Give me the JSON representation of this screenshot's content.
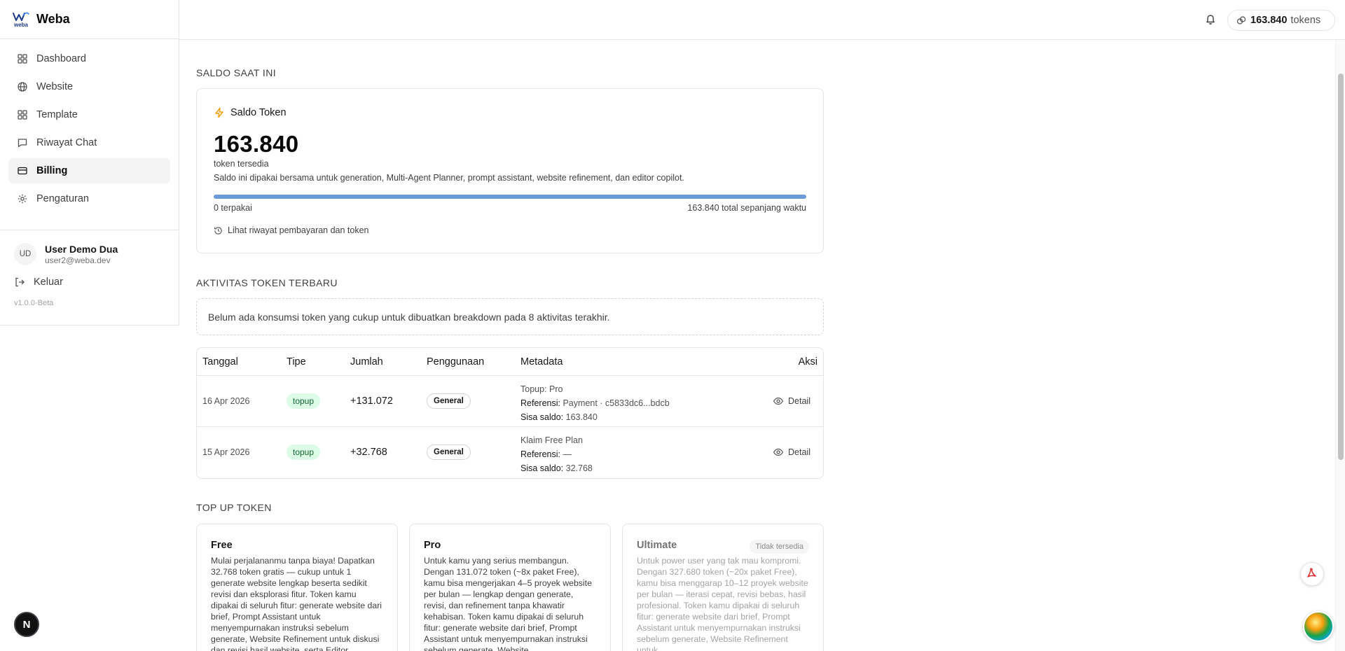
{
  "brand": {
    "name": "Weba",
    "logo_text": "weba"
  },
  "sidebar": {
    "items": [
      {
        "label": "Dashboard",
        "icon": "dashboard-icon",
        "active": false
      },
      {
        "label": "Website",
        "icon": "globe-icon",
        "active": false
      },
      {
        "label": "Template",
        "icon": "template-grid-icon",
        "active": false
      },
      {
        "label": "Riwayat Chat",
        "icon": "chat-icon",
        "active": false
      },
      {
        "label": "Billing",
        "icon": "credit-card-icon",
        "active": true
      },
      {
        "label": "Pengaturan",
        "icon": "gear-icon",
        "active": false
      }
    ],
    "user": {
      "initials": "UD",
      "name": "User Demo Dua",
      "email": "user2@weba.dev"
    },
    "logout_label": "Keluar",
    "version": "v1.0.0-Beta"
  },
  "header": {
    "token_count": "163.840",
    "token_unit": "tokens"
  },
  "saldo": {
    "section_title": "SALDO SAAT INI",
    "card_title": "Saldo Token",
    "amount": "163.840",
    "amount_sub": "token tersedia",
    "description": "Saldo ini dipakai bersama untuk generation, Multi-Agent Planner, prompt assistant, website refinement, dan editor copilot.",
    "used_label": "0 terpakai",
    "total_label": "163.840 total sepanjang waktu",
    "remaining_fraction": 1.0,
    "history_link": "Lihat riwayat pembayaran dan token"
  },
  "activity": {
    "section_title": "AKTIVITAS TOKEN TERBARU",
    "empty_message": "Belum ada konsumsi token yang cukup untuk dibuatkan breakdown pada 8 aktivitas terakhir.",
    "columns": [
      "Tanggal",
      "Tipe",
      "Jumlah",
      "Penggunaan",
      "Metadata",
      "Aksi"
    ],
    "rows": [
      {
        "date": "16 Apr 2026",
        "type": "topup",
        "amount": "+131.072",
        "usage": "General",
        "meta_line1": "Topup: Pro",
        "ref_label": "Referensi:",
        "ref_value": "Payment · c5833dc6...bdcb",
        "balance_label": "Sisa saldo:",
        "balance_value": "163.840",
        "action": "Detail"
      },
      {
        "date": "15 Apr 2026",
        "type": "topup",
        "amount": "+32.768",
        "usage": "General",
        "meta_line1": "Klaim Free Plan",
        "ref_label": "Referensi:",
        "ref_value": "—",
        "balance_label": "Sisa saldo:",
        "balance_value": "32.768",
        "action": "Detail"
      }
    ]
  },
  "topup": {
    "section_title": "TOP UP TOKEN",
    "plans": [
      {
        "name": "Free",
        "description": "Mulai perjalananmu tanpa biaya! Dapatkan 32.768 token gratis — cukup untuk 1 generate website lengkap beserta sedikit revisi dan eksplorasi fitur. Token kamu dipakai di seluruh fitur: generate website dari brief, Prompt Assistant untuk menyempurnakan instruksi sebelum generate, Website Refinement untuk diskusi dan revisi hasil website, serta Editor",
        "available": true
      },
      {
        "name": "Pro",
        "description": "Untuk kamu yang serius membangun. Dengan 131.072 token (~8x paket Free), kamu bisa mengerjakan 4–5 proyek website per bulan — lengkap dengan generate, revisi, dan refinement tanpa khawatir kehabisan. Token kamu dipakai di seluruh fitur: generate website dari brief, Prompt Assistant untuk menyempurnakan instruksi sebelum generate. Website",
        "available": true
      },
      {
        "name": "Ultimate",
        "badge": "Tidak tersedia",
        "description": "Untuk power user yang tak mau kompromi. Dengan 327.680 token (~20x paket Free), kamu bisa menggarap 10–12 proyek website per bulan — iterasi cepat, revisi bebas, hasil profesional. Token kamu dipakai di seluruh fitur: generate website dari brief, Prompt Assistant untuk menyempurnakan instruksi sebelum generate, Website Refinement untuk",
        "available": false
      }
    ]
  },
  "floating": {
    "n_button": "N"
  }
}
